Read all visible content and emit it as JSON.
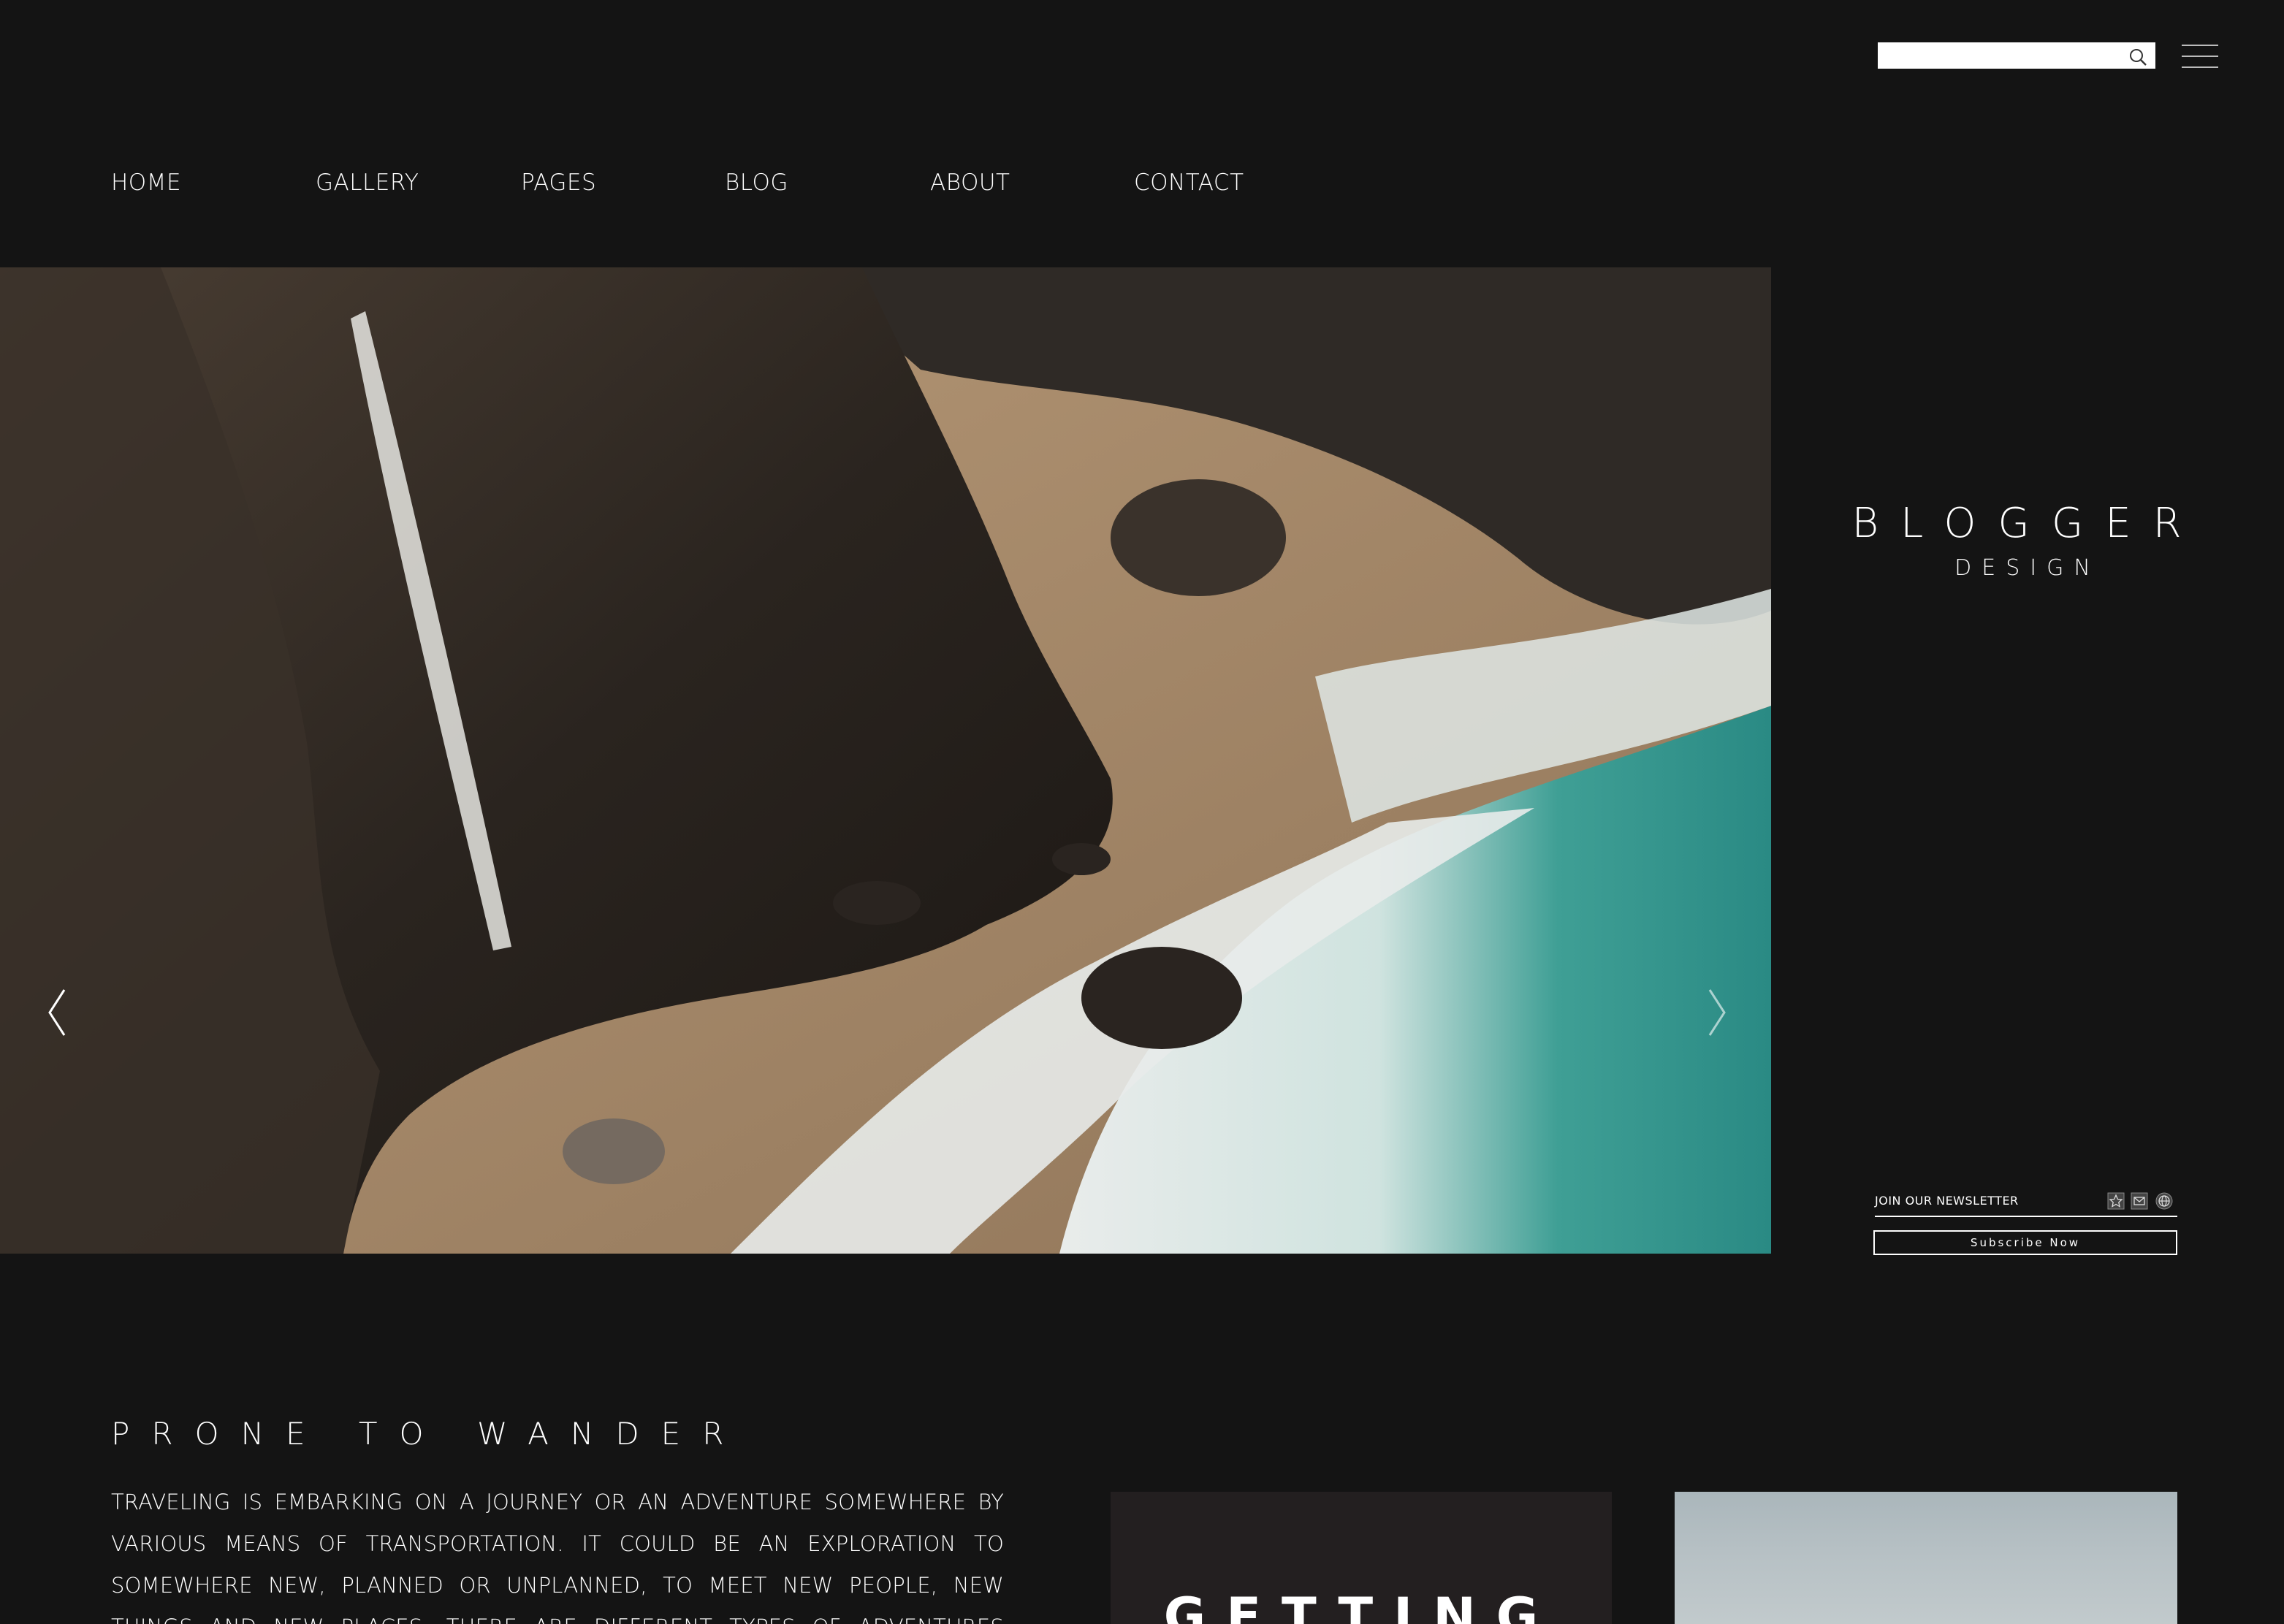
{
  "header": {
    "search": {
      "placeholder": "",
      "value": ""
    },
    "menu_icon": "hamburger-icon",
    "search_icon": "search-icon"
  },
  "nav": {
    "items": [
      {
        "label": "HOME"
      },
      {
        "label": "GALLERY"
      },
      {
        "label": "PAGES"
      },
      {
        "label": "BLOG"
      },
      {
        "label": "ABOUT"
      },
      {
        "label": "CONTACT"
      }
    ]
  },
  "hero": {
    "image": "rocky coastline with waterfall and turquoise surf",
    "prev_icon": "chevron-left-icon",
    "next_icon": "chevron-right-icon"
  },
  "brand": {
    "title": "BLOGGER",
    "subtitle": "DESIGN"
  },
  "newsletter": {
    "label": "JOIN OUR NEWSLETTER",
    "social_icons": [
      "instagram-icon",
      "mail-icon",
      "globe-icon"
    ],
    "subscribe_label": "Subscribe Now"
  },
  "section": {
    "title": "PRONE TO WANDER",
    "body": "TRAVELING IS EMBARKING ON A JOURNEY OR AN ADVENTURE SOMEWHERE BY VARIOUS MEANS OF TRANSPORTATION. IT COULD BE AN EXPLORATION TO SOMEWHERE NEW, PLANNED OR UNPLANNED, TO MEET NEW PEOPLE, NEW THINGS AND NEW PLACES. THERE ARE DIFFERENT TYPES OF ADVENTURES WAITING FOR YOU TO EXPLORE.",
    "card_title": "GETTING"
  },
  "colors": {
    "background": "#141414",
    "text": "#ffffff",
    "card_dark": "#231f20",
    "sea": "#2f9a90"
  }
}
